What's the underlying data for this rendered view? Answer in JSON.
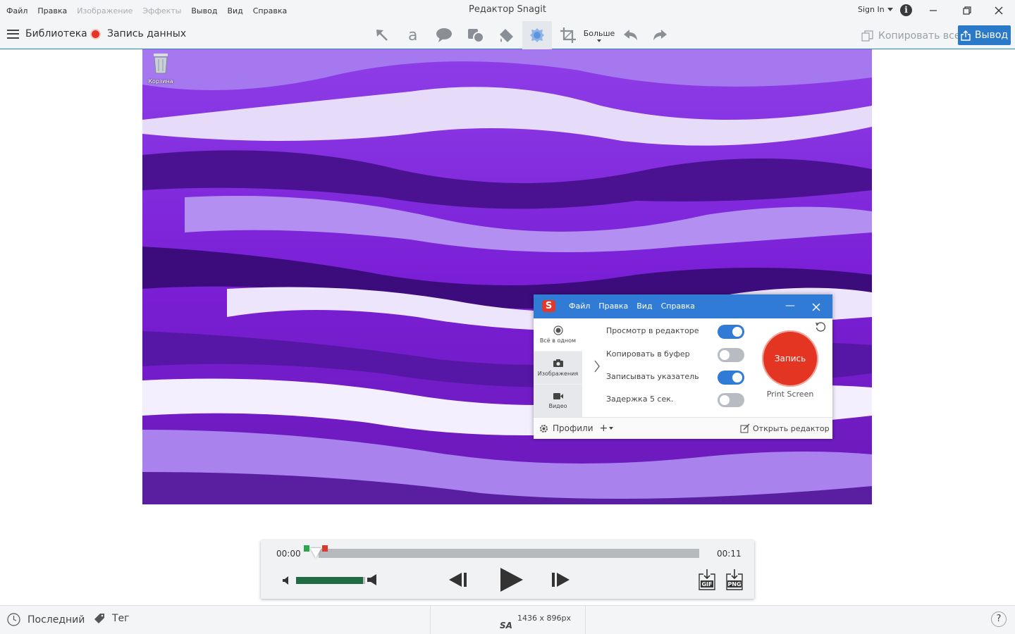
{
  "titlebar": {
    "title": "Редактор Snagit",
    "menu": [
      "Файл",
      "Правка",
      "Изображение",
      "Эффекты",
      "Вывод",
      "Вид",
      "Справка"
    ],
    "sign_in": "Sign In"
  },
  "toolbar": {
    "library": "Библиотека",
    "capture": "Запись данных",
    "more": "Больше",
    "copy_all": "Копировать все",
    "share": "Вывод",
    "tools": [
      "arrow-tool-icon",
      "text-tool-icon",
      "callout-tool-icon",
      "shape-tool-icon",
      "fill-tool-icon",
      "step-tool-icon",
      "crop-tool-icon"
    ]
  },
  "desktop": {
    "recycle_bin": "Корзина"
  },
  "snagit_capture": {
    "menu": [
      "Файл",
      "Правка",
      "Вид",
      "Справка"
    ],
    "tabs": [
      "Всё в одном",
      "Изображения",
      "Видео"
    ],
    "options": [
      {
        "label": "Просмотр в редакторе",
        "enabled": true
      },
      {
        "label": "Копировать в буфер",
        "enabled": false
      },
      {
        "label": "Записывать указатель",
        "enabled": true
      },
      {
        "label": "Задержка 5 сек.",
        "enabled": false
      }
    ],
    "record_button": "Запись",
    "hotkey": "Print Screen",
    "profiles": "Профили",
    "add_profile": "+",
    "open_editor": "Открыть редактор"
  },
  "player": {
    "time_start": "00:00",
    "time_end": "00:11",
    "export_gif": "GIF",
    "export_png": "PNG"
  },
  "statusbar": {
    "recent": "Последний",
    "tag": "Тег",
    "dimensions": "1436 x 896px",
    "help": "?",
    "sa_label": "SA"
  },
  "colors": {
    "accent": "#2f7bd6",
    "record": "#e43422",
    "wallpaper": "#7a1fd6"
  }
}
